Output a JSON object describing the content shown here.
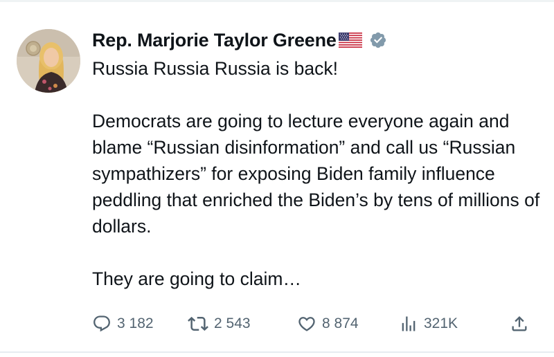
{
  "author": {
    "display_name": "Rep. Marjorie Taylor Greene",
    "flag_icon": "us-flag-icon",
    "verified_icon": "verified-badge-icon",
    "verified_color": "#829aab"
  },
  "post": {
    "paragraphs": [
      "Russia Russia Russia is back!",
      "Democrats are going to lecture everyone again and blame “Russian disinformation” and call us “Russian  sympathizers” for exposing Biden family influence peddling that enriched the Biden’s by tens of millions of dollars.",
      "They are going to claim…"
    ]
  },
  "actions": {
    "replies": "3 182",
    "reposts": "2 543",
    "likes": "8 874",
    "views": "321K"
  },
  "colors": {
    "text": "#0f1419",
    "muted": "#536471"
  }
}
